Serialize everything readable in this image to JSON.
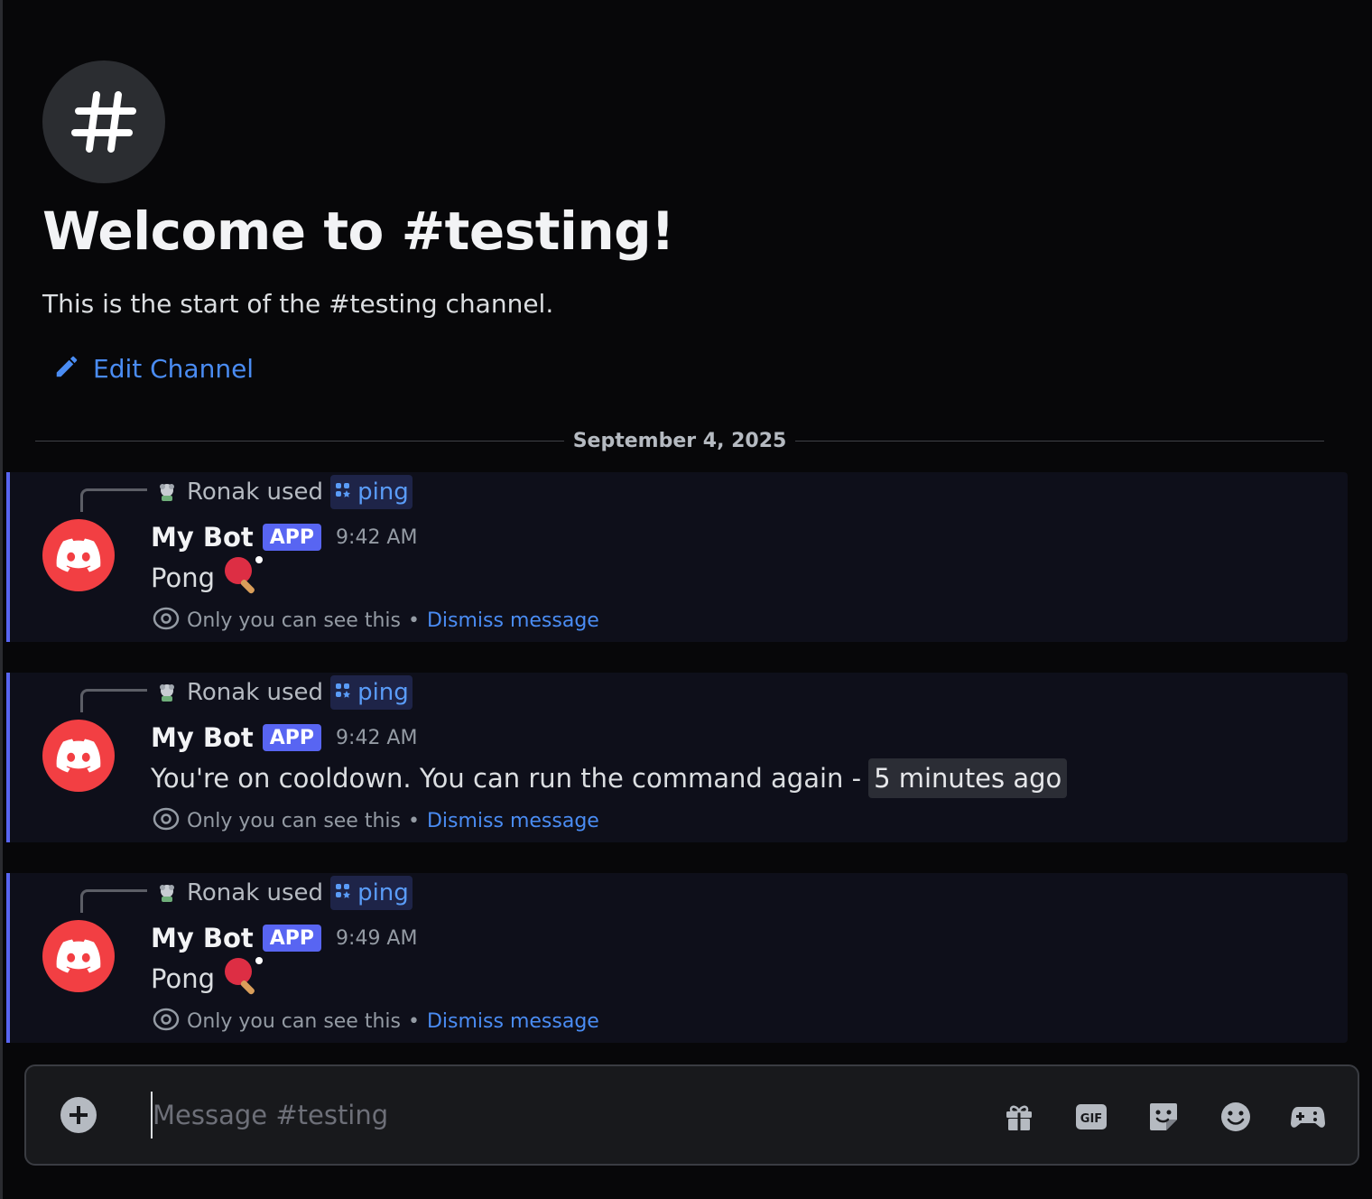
{
  "channel": {
    "icon": "hash-icon",
    "welcome_title": "Welcome to #testing!",
    "welcome_subtitle": "This is the start of the #testing channel.",
    "edit_label": "Edit Channel"
  },
  "date_divider": "September 4, 2025",
  "messages": [
    {
      "reply_user": "Ronak used",
      "reply_command": "ping",
      "author": "My Bot",
      "badge": "APP",
      "time": "9:42 AM",
      "text": "Pong",
      "emoji": "ping-pong-icon",
      "ephemeral_note": "Only you can see this",
      "separator": "•",
      "dismiss_label": "Dismiss message"
    },
    {
      "reply_user": "Ronak used",
      "reply_command": "ping",
      "author": "My Bot",
      "badge": "APP",
      "time": "9:42 AM",
      "text": "You're on cooldown. You can run the command again -",
      "timestamp_chip": "5 minutes ago",
      "ephemeral_note": "Only you can see this",
      "separator": "•",
      "dismiss_label": "Dismiss message"
    },
    {
      "reply_user": "Ronak used",
      "reply_command": "ping",
      "author": "My Bot",
      "badge": "APP",
      "time": "9:49 AM",
      "text": "Pong",
      "emoji": "ping-pong-icon",
      "ephemeral_note": "Only you can see this",
      "separator": "•",
      "dismiss_label": "Dismiss message"
    }
  ],
  "composer": {
    "placeholder": "Message #testing",
    "tools": [
      "gift-icon",
      "gif-icon",
      "sticker-icon",
      "emoji-icon",
      "activities-icon"
    ]
  },
  "colors": {
    "background": "#070709",
    "message_highlight": "#0e0f1a",
    "accent": "#5865f2",
    "link": "#4a8cf3",
    "avatar": "#f23f43"
  }
}
